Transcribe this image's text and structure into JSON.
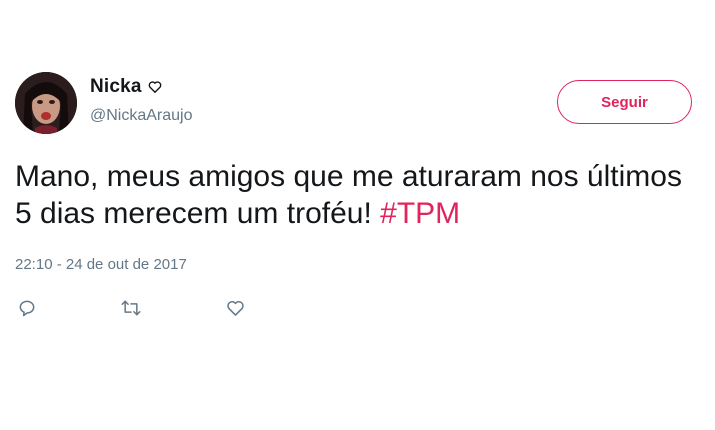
{
  "tweet": {
    "author": {
      "display_name": "Nicka",
      "badge_icon": "heart-outline-icon",
      "handle": "@NickaAraujo",
      "avatar_icon": "profile-photo"
    },
    "follow_button": {
      "label": "Seguir",
      "color": "#e0245e"
    },
    "text_main": "Mano, meus amigos que me aturaram nos últimos 5 dias merecem um troféu! ",
    "hashtag": "#TPM",
    "timestamp": "22:10 - 24 de out de 2017",
    "actions": {
      "reply_icon": "reply-icon",
      "retweet_icon": "retweet-icon",
      "like_icon": "like-heart-icon"
    },
    "colors": {
      "accent": "#e0245e",
      "text": "#14171a",
      "secondary": "#657786"
    }
  }
}
